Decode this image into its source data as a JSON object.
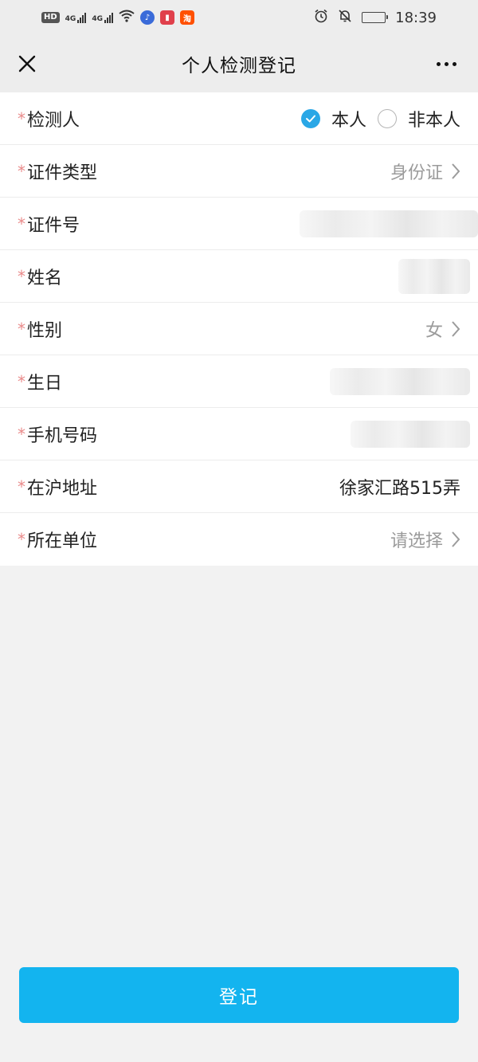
{
  "status_bar": {
    "hd": "HD",
    "sim1_tag": "4G",
    "sim2_tag": "4G",
    "taobao": "淘",
    "time": "18:39",
    "icons": [
      "hd-icon",
      "signal-icon",
      "wifi-icon",
      "music-app-icon",
      "book-app-icon",
      "taobao-app-icon",
      "alarm-icon",
      "bell-off-icon",
      "battery-icon"
    ]
  },
  "nav": {
    "title": "个人检测登记",
    "icons": [
      "close-icon",
      "more-icon"
    ]
  },
  "form": {
    "required_mark": "*",
    "tester": {
      "label": "检测人",
      "options": [
        "本人",
        "非本人"
      ],
      "selected": "本人"
    },
    "id_type": {
      "label": "证件类型",
      "value": "身份证"
    },
    "id_number": {
      "label": "证件号"
    },
    "name": {
      "label": "姓名"
    },
    "gender": {
      "label": "性别",
      "value": "女"
    },
    "birthday": {
      "label": "生日"
    },
    "phone": {
      "label": "手机号码"
    },
    "address": {
      "label": "在沪地址",
      "value": "徐家汇路515弄"
    },
    "employer": {
      "label": "所在单位",
      "placeholder": "请选择"
    }
  },
  "submit": {
    "label": "登记"
  },
  "colors": {
    "accent": "#13b4ef",
    "radio": "#2aa7e6",
    "required": "#e98a8a",
    "battery_low": "#e23b3b"
  }
}
